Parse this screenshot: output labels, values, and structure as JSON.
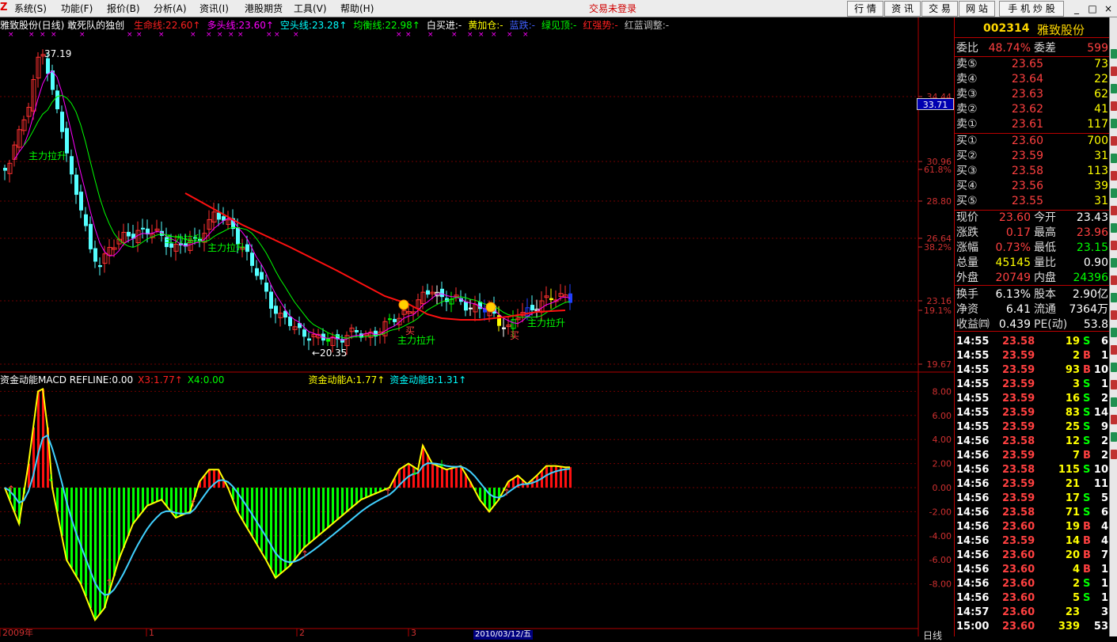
{
  "menu": {
    "items": [
      "系统(S)",
      "功能(F)",
      "报价(B)",
      "分析(A)",
      "资讯(I)",
      "港股期货",
      "工具(V)",
      "帮助(H)"
    ],
    "login_status": "交易未登录",
    "buttons": [
      "行 情",
      "资 讯",
      "交 易",
      "网 站",
      "手 机 炒 股"
    ],
    "window_controls": [
      "_",
      "□",
      "×"
    ]
  },
  "colors": {
    "accent_red": "#ff2020",
    "yellow": "#ffff00",
    "green": "#00ff00",
    "cyan": "#00ffff",
    "magenta": "#ff00ff",
    "blue": "#4060ff"
  },
  "main_legend": {
    "title": "雅致股份(日线) 敢死队的独创",
    "items": [
      {
        "text": "生命线:22.60↑",
        "color": "#ff2020"
      },
      {
        "text": "多头线:23.60↑",
        "color": "#ff00ff"
      },
      {
        "text": "空头线:23.28↑",
        "color": "#00ffff"
      },
      {
        "text": "均衡线:22.98↑",
        "color": "#00ff00"
      },
      {
        "text": "白买进:-",
        "color": "#ffffff"
      },
      {
        "text": "黄加仓:-",
        "color": "#ffff00"
      },
      {
        "text": "蓝跌:-",
        "color": "#4060ff"
      },
      {
        "text": "绿见顶:-",
        "color": "#00ff00"
      },
      {
        "text": "红强势:-",
        "color": "#ff2020"
      },
      {
        "text": "红蓝调整:-",
        "color": "#c0c0c0"
      }
    ]
  },
  "sub_legend": {
    "items": [
      {
        "text": "资金动能MACD  REFLINE:0.00",
        "color": "#ffffff"
      },
      {
        "text": "X3:1.77↑",
        "color": "#ff2020"
      },
      {
        "text": "X4:0.00",
        "color": "#00ff00"
      },
      {
        "text": "资金动能A:1.77↑",
        "color": "#ffff00"
      },
      {
        "text": "资金动能B:1.31↑",
        "color": "#00ffff"
      }
    ]
  },
  "price_axis": [
    "34.44",
    "30.96",
    "61.8%",
    "28.80",
    "26.64",
    "38.2%",
    "23.16",
    "19.1%",
    "19.67"
  ],
  "sub_axis": [
    "8.00",
    "6.00",
    "4.00",
    "2.00",
    "0.00",
    "-2.00",
    "-4.00",
    "-6.00",
    "-8.00"
  ],
  "current_price_tag": "33.71",
  "annotations": {
    "high": "37.19",
    "low": "←20.35",
    "rally": "主力拉升",
    "buy": "买",
    "buy_marker": "买"
  },
  "date_axis": {
    "labels": [
      "2009年",
      "1",
      "2",
      "3"
    ],
    "highlight": "2010/03/12/五"
  },
  "period": "日线",
  "stock": {
    "code": "002314",
    "name": "雅致股份"
  },
  "quote": {
    "weibi_label": "委比",
    "weibi": "48.74%",
    "weicha_label": "委差",
    "weicha": "599",
    "asks": [
      {
        "label": "卖⑤",
        "price": "23.65",
        "vol": "73"
      },
      {
        "label": "卖④",
        "price": "23.64",
        "vol": "22"
      },
      {
        "label": "卖③",
        "price": "23.63",
        "vol": "62"
      },
      {
        "label": "卖②",
        "price": "23.62",
        "vol": "41"
      },
      {
        "label": "卖①",
        "price": "23.61",
        "vol": "117"
      }
    ],
    "bids": [
      {
        "label": "买①",
        "price": "23.60",
        "vol": "700"
      },
      {
        "label": "买②",
        "price": "23.59",
        "vol": "31"
      },
      {
        "label": "买③",
        "price": "23.58",
        "vol": "113"
      },
      {
        "label": "买④",
        "price": "23.56",
        "vol": "39"
      },
      {
        "label": "买⑤",
        "price": "23.55",
        "vol": "31"
      }
    ],
    "stats": [
      {
        "l1": "现价",
        "v1": "23.60",
        "c1": "#ff4040",
        "l2": "今开",
        "v2": "23.43",
        "c2": "#ffffff"
      },
      {
        "l1": "涨跌",
        "v1": "0.17",
        "c1": "#ff4040",
        "l2": "最高",
        "v2": "23.96",
        "c2": "#ff4040"
      },
      {
        "l1": "涨幅",
        "v1": "0.73%",
        "c1": "#ff4040",
        "l2": "最低",
        "v2": "23.15",
        "c2": "#00ff00"
      },
      {
        "l1": "总量",
        "v1": "45145",
        "c1": "#ffff00",
        "l2": "量比",
        "v2": "0.90",
        "c2": "#ffffff"
      },
      {
        "l1": "外盘",
        "v1": "20749",
        "c1": "#ff4040",
        "l2": "内盘",
        "v2": "24396",
        "c2": "#00ff00"
      }
    ],
    "stats2": [
      {
        "l1": "换手",
        "v1": "6.13%",
        "l2": "股本",
        "v2": "2.90亿"
      },
      {
        "l1": "净资",
        "v1": "6.41",
        "l2": "流通",
        "v2": "7364万"
      },
      {
        "l1": "收益㈣",
        "v1": "0.439",
        "l2": "PE(动)",
        "v2": "53.8"
      }
    ]
  },
  "ticks": [
    {
      "time": "14:55",
      "price": "23.58",
      "vol": "19",
      "bs": "S",
      "n": "6"
    },
    {
      "time": "14:55",
      "price": "23.59",
      "vol": "2",
      "bs": "B",
      "n": "1"
    },
    {
      "time": "14:55",
      "price": "23.59",
      "vol": "93",
      "bs": "B",
      "n": "10"
    },
    {
      "time": "14:55",
      "price": "23.59",
      "vol": "3",
      "bs": "S",
      "n": "1"
    },
    {
      "time": "14:55",
      "price": "23.59",
      "vol": "16",
      "bs": "S",
      "n": "2"
    },
    {
      "time": "14:55",
      "price": "23.59",
      "vol": "83",
      "bs": "S",
      "n": "14"
    },
    {
      "time": "14:55",
      "price": "23.59",
      "vol": "25",
      "bs": "S",
      "n": "9"
    },
    {
      "time": "14:56",
      "price": "23.58",
      "vol": "12",
      "bs": "S",
      "n": "2"
    },
    {
      "time": "14:56",
      "price": "23.59",
      "vol": "7",
      "bs": "B",
      "n": "2"
    },
    {
      "time": "14:56",
      "price": "23.58",
      "vol": "115",
      "bs": "S",
      "n": "10"
    },
    {
      "time": "14:56",
      "price": "23.59",
      "vol": "21",
      "bs": "",
      "n": "11"
    },
    {
      "time": "14:56",
      "price": "23.59",
      "vol": "17",
      "bs": "S",
      "n": "5"
    },
    {
      "time": "14:56",
      "price": "23.58",
      "vol": "71",
      "bs": "S",
      "n": "6"
    },
    {
      "time": "14:56",
      "price": "23.60",
      "vol": "19",
      "bs": "B",
      "n": "4"
    },
    {
      "time": "14:56",
      "price": "23.59",
      "vol": "14",
      "bs": "B",
      "n": "4"
    },
    {
      "time": "14:56",
      "price": "23.60",
      "vol": "20",
      "bs": "B",
      "n": "7"
    },
    {
      "time": "14:56",
      "price": "23.60",
      "vol": "4",
      "bs": "B",
      "n": "1"
    },
    {
      "time": "14:56",
      "price": "23.60",
      "vol": "2",
      "bs": "S",
      "n": "1"
    },
    {
      "time": "14:56",
      "price": "23.60",
      "vol": "5",
      "bs": "S",
      "n": "1"
    },
    {
      "time": "14:57",
      "price": "23.60",
      "vol": "23",
      "bs": "",
      "n": "3"
    },
    {
      "time": "15:00",
      "price": "23.60",
      "vol": "339",
      "bs": "",
      "n": "53"
    }
  ]
}
